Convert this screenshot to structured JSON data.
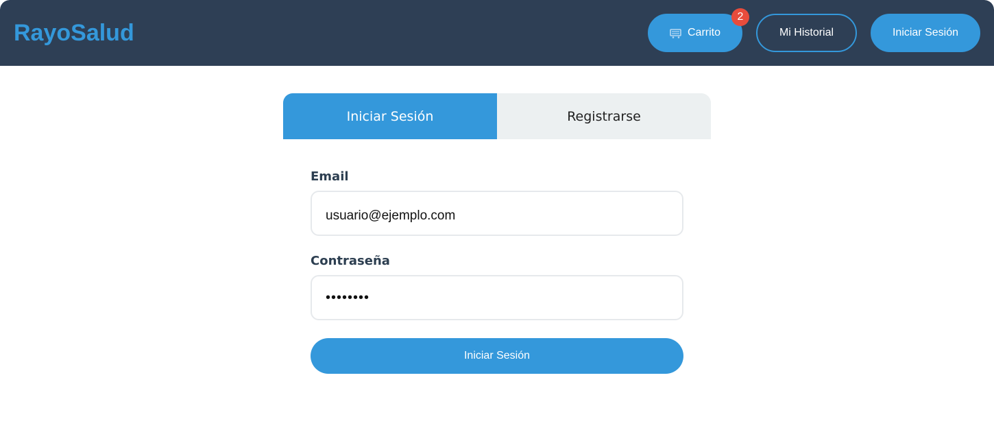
{
  "app": {
    "logo": "RayoSalud"
  },
  "header": {
    "cart_label": "Carrito",
    "cart_icon": "shopping-cart-icon",
    "cart_badge_count": "2",
    "history_label": "Mi Historial",
    "login_label": "Iniciar Sesión"
  },
  "tabs": [
    {
      "label": "Iniciar Sesión",
      "active": true
    },
    {
      "label": "Registrarse",
      "active": false
    }
  ],
  "form": {
    "email_label": "Email",
    "email_value": "usuario@ejemplo.com",
    "password_label": "Contraseña",
    "password_value": "••••••••",
    "submit_label": "Iniciar Sesión"
  },
  "colors": {
    "header_bg": "#2e3f55",
    "accent": "#3498db",
    "badge": "#e74c3c",
    "tab_inactive_bg": "#ecf0f1",
    "label_text": "#2c3e50"
  }
}
